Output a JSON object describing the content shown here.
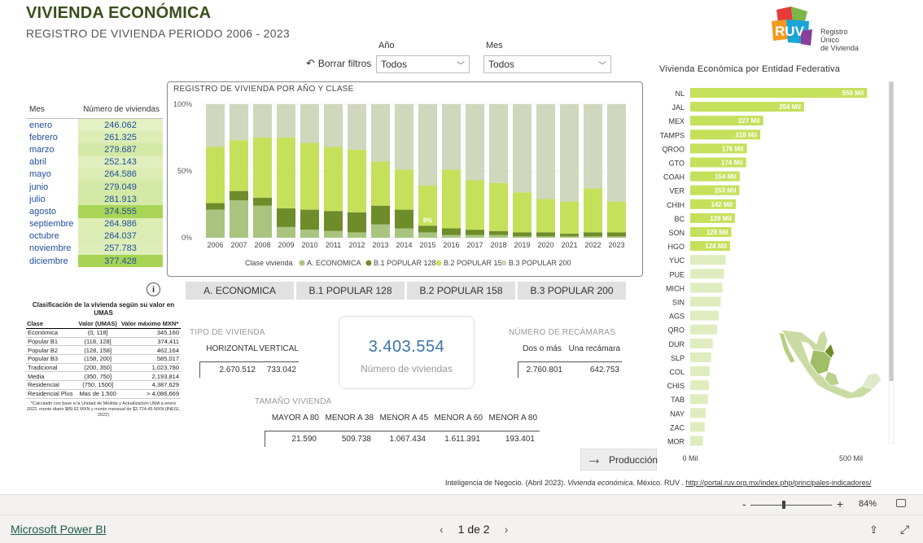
{
  "header": {
    "title": "VIVIENDA ECONÓMICA",
    "subtitle": "REGISTRO DE VIVIENDA PERIODO 2006 - 2023",
    "logo_text_1": "Registro Único",
    "logo_text_2": "de Vivienda",
    "logo_mark": "RUV"
  },
  "filters": {
    "reset_label": "Borrar filtros",
    "year_label": "Año",
    "year_value": "Todos",
    "month_label": "Mes",
    "month_value": "Todos"
  },
  "month_table": {
    "col_month": "Mes",
    "col_count": "Número de viviendas",
    "rows": [
      {
        "m": "enero",
        "v": "246.062",
        "n": 246062
      },
      {
        "m": "febrero",
        "v": "261.325",
        "n": 261325
      },
      {
        "m": "marzo",
        "v": "279.687",
        "n": 279687
      },
      {
        "m": "abril",
        "v": "252.143",
        "n": 252143
      },
      {
        "m": "mayo",
        "v": "264.586",
        "n": 264586
      },
      {
        "m": "junio",
        "v": "279.049",
        "n": 279049
      },
      {
        "m": "julio",
        "v": "281.913",
        "n": 281913
      },
      {
        "m": "agosto",
        "v": "374.555",
        "n": 374555
      },
      {
        "m": "septiembre",
        "v": "264.986",
        "n": 264986
      },
      {
        "m": "octubre",
        "v": "264.037",
        "n": 264037
      },
      {
        "m": "noviembre",
        "v": "257.783",
        "n": 257783
      },
      {
        "m": "diciembre",
        "v": "377.428",
        "n": 377428
      }
    ]
  },
  "chart_data": [
    {
      "type": "bar",
      "stacked": "percent",
      "title": "REGISTRO DE VIVIENDA POR AÑO Y CLASE",
      "legend_title": "Clase vivienda",
      "legend_position": "bottom",
      "yticks": [
        "100%",
        "50%",
        "0%"
      ],
      "categories": [
        "2006",
        "2007",
        "2008",
        "2009",
        "2010",
        "2011",
        "2012",
        "2013",
        "2014",
        "2015",
        "2016",
        "2017",
        "2018",
        "2019",
        "2020",
        "2021",
        "2022",
        "2023"
      ],
      "series": [
        {
          "name": "A. ECONOMICA",
          "color": "#a9c47f",
          "values": [
            21,
            28,
            24,
            8,
            6,
            5,
            4,
            10,
            7,
            4,
            2,
            2,
            2,
            1,
            1,
            1,
            1,
            1
          ]
        },
        {
          "name": "B.1 POPULAR 128",
          "color": "#6e8c2a",
          "values": [
            5,
            7,
            6,
            14,
            15,
            15,
            15,
            14,
            14,
            5,
            5,
            4,
            3,
            3,
            3,
            2,
            3,
            3
          ]
        },
        {
          "name": "B.2 POPULAR 158",
          "color": "#c5e05b",
          "values": [
            42,
            38,
            45,
            53,
            50,
            48,
            47,
            33,
            30,
            30,
            44,
            37,
            36,
            30,
            25,
            24,
            33,
            23
          ]
        },
        {
          "name": "B.3 POPULAR 200",
          "color": "#cfd7bc",
          "values": [
            32,
            27,
            25,
            25,
            29,
            32,
            34,
            43,
            49,
            61,
            49,
            57,
            59,
            66,
            71,
            73,
            63,
            73
          ]
        }
      ],
      "data_labels": [
        {
          "category": "2015",
          "series": "B.1 POPULAR 128",
          "text": "9%"
        }
      ]
    },
    {
      "type": "bar",
      "orientation": "horizontal",
      "title": "Vivienda Económica por Entidad Federativa",
      "xticks": [
        "0 Mil",
        "500 Mil"
      ],
      "xlim": [
        0,
        600000
      ],
      "categories": [
        "NL",
        "JAL",
        "MEX",
        "TAMPS",
        "QROO",
        "GTO",
        "COAH",
        "VER",
        "CHIH",
        "BC",
        "SON",
        "HGO",
        "YUC",
        "PUE",
        "MICH",
        "SIN",
        "AGS",
        "QRO",
        "DUR",
        "SLP",
        "COL",
        "CHIS",
        "TAB",
        "NAY",
        "ZAC",
        "MOR"
      ],
      "values": [
        550000,
        354000,
        227000,
        218000,
        176000,
        174000,
        154000,
        153000,
        142000,
        139000,
        128000,
        124000,
        110000,
        105000,
        100000,
        95000,
        88000,
        84000,
        70000,
        65000,
        60000,
        58000,
        55000,
        48000,
        45000,
        40000
      ],
      "labels": [
        "550 Mil",
        "354 Mil",
        "227 Mil",
        "218 Mil",
        "176 Mil",
        "174 Mil",
        "154 Mil",
        "153 Mil",
        "142 Mil",
        "139 Mil",
        "128 Mil",
        "124 Mil",
        "",
        "",
        "",
        "",
        "",
        "",
        "",
        "",
        "",
        "",
        "",
        "",
        "",
        ""
      ],
      "color": "#c5e05b"
    }
  ],
  "class_buttons": [
    "A. ECONOMICA",
    "B.1 POPULAR 128",
    "B.2 POPULAR 158",
    "B.3 POPULAR 200"
  ],
  "umas": {
    "caption": "Clasificación de la vivienda según su valor en UMAS",
    "col_class": "Clase",
    "col_value": "Valor (UMAS)",
    "col_max": "Valor máximo MXN*",
    "rows": [
      {
        "c": "Económica",
        "v": "(0, 118]",
        "m": "345,160"
      },
      {
        "c": "Popular B1",
        "v": "(118, 128]",
        "m": "374,411"
      },
      {
        "c": "Popular B2",
        "v": "(128, 158]",
        "m": "462,164"
      },
      {
        "c": "Popular B3",
        "v": "(158, 200]",
        "m": "585,017"
      },
      {
        "c": "Tradicional",
        "v": "(200, 350]",
        "m": "1,023,780"
      },
      {
        "c": "Media",
        "v": "(350, 750]",
        "m": "2,193,814"
      },
      {
        "c": "Residencial",
        "v": "(750, 1500]",
        "m": "4,387,629"
      },
      {
        "c": "Residencial Plus",
        "v": "Mas de 1,500",
        "m": "> 4,086,669"
      }
    ],
    "note": "*Calculado con base a la Unidad de Medida y Actualización UMA a enero 2022, monto diario $89.62 MXN y monto mensual de $2,724.45 MXN (INEGI, 2022)"
  },
  "tipo": {
    "label": "TIPO DE VIVIENDA",
    "h1": "HORIZONTAL",
    "h2": "VERTICAL",
    "v1": "2.670.512",
    "v2": "733.042"
  },
  "kpi": {
    "value": "3.403.554",
    "label": "Número de viviendas"
  },
  "recamaras": {
    "label": "NÚMERO DE RECÁMARAS",
    "h1": "Dos o más",
    "h2": "Una recámara",
    "v1": "2.760.801",
    "v2": "642.753"
  },
  "tamano": {
    "label": "TAMAÑO VIVIENDA",
    "heads": [
      "MAYOR A 80",
      "MENOR A 38",
      "MENOR A 45",
      "MENOR A 60",
      "MENOR A 80"
    ],
    "values": [
      "21.590",
      "509.738",
      "1.067.434",
      "1.611.391",
      "193.401"
    ]
  },
  "production_button": "Producción",
  "citation": {
    "prefix": "Inteligencia de Negocio. (Abril 2023). ",
    "italic": "Vivienda económica",
    "middle": ". México. RUV . ",
    "link": "http://portal.ruv.org.mx/index.php/principales-indicadores/"
  },
  "zoom": {
    "value": "84%",
    "minus": "-",
    "plus": "+"
  },
  "footer": {
    "brand": "Microsoft Power BI",
    "page": "1 de 2"
  },
  "colors": {
    "accent_green": "#c5e05b",
    "dark_green": "#6e8c2a",
    "title_green": "#3a4f1b",
    "kpi_blue": "#3a73a6"
  }
}
